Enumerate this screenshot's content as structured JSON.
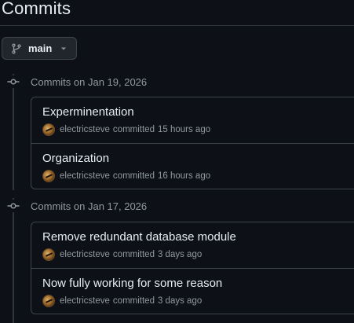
{
  "page": {
    "title": "Commits"
  },
  "branch": {
    "label": "main",
    "icon": "git-branch-icon"
  },
  "groups": [
    {
      "label": "Commits on Jan 19, 2026",
      "commits": [
        {
          "message": "Experminentation",
          "author": "electricsteve",
          "action": "committed",
          "time": "15 hours ago"
        },
        {
          "message": "Organization",
          "author": "electricsteve",
          "action": "committed",
          "time": "16 hours ago"
        }
      ]
    },
    {
      "label": "Commits on Jan 17, 2026",
      "commits": [
        {
          "message": "Remove redundant database module",
          "author": "electricsteve",
          "action": "committed",
          "time": "3 days ago"
        },
        {
          "message": "Now fully working for some reason",
          "author": "electricsteve",
          "action": "committed",
          "time": "3 days ago"
        }
      ]
    }
  ],
  "colors": {
    "background": "#0d1117",
    "border": "#3d444d",
    "text": "#e6edf3",
    "muted": "#9198a1"
  }
}
